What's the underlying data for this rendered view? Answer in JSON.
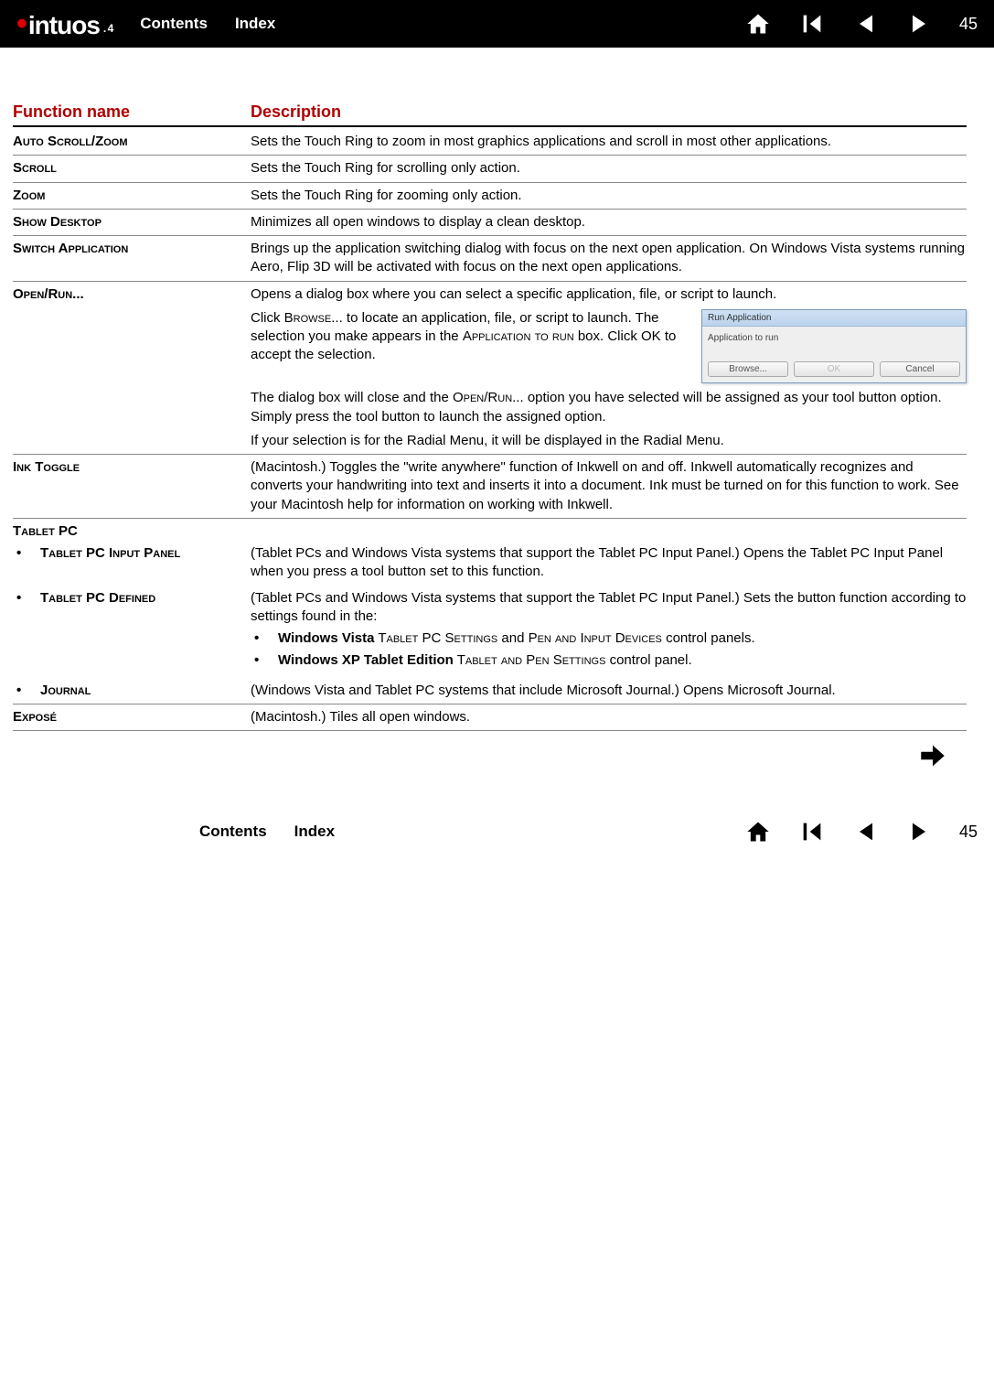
{
  "nav": {
    "contents": "Contents",
    "index": "Index",
    "page": "45",
    "logo_brand": "intuos",
    "logo_sub": "4"
  },
  "headers": {
    "func": "Function name",
    "desc": "Description"
  },
  "rows": {
    "auto_scroll_zoom": {
      "name": "Auto Scroll/Zoom",
      "desc": "Sets the Touch Ring to zoom in most graphics applications and scroll in most other applications."
    },
    "scroll": {
      "name": "Scroll",
      "desc": "Sets the Touch Ring for scrolling only action."
    },
    "zoom": {
      "name": "Zoom",
      "desc": "Sets the Touch Ring for zooming only action."
    },
    "show_desktop": {
      "name": "Show Desktop",
      "desc": "Minimizes all open windows to display a clean desktop."
    },
    "switch_app": {
      "name": "Switch Application",
      "desc": "Brings up the application switching dialog with focus on the next open application. On Windows Vista systems running Aero, Flip 3D will be activated with focus on the next open applications."
    },
    "open_run": {
      "name": "Open/Run...",
      "desc_intro": "Opens a dialog box where you can select a specific application, file, or script to launch.",
      "desc_browse_pre": "Click ",
      "desc_browse_sc": "Browse...",
      "desc_browse_mid": " to locate an application, file, or script  to launch.  The selection you make appears in the ",
      "desc_browse_sc2": "Application to run",
      "desc_browse_post": " box.  Click OK to accept the selection.",
      "desc_close_pre": "The dialog box will close and the ",
      "desc_close_sc": "Open/Run...",
      "desc_close_post": " option you have selected will be assigned as your tool button option.  Simply press the tool button to launch the assigned option.",
      "desc_radial": "If your selection is for the Radial Menu, it will be displayed in the Radial Menu."
    },
    "ink_toggle": {
      "name": "Ink Toggle",
      "desc": "(Macintosh.)  Toggles the \"write anywhere\" function of Inkwell on and off.  Inkwell automatically recognizes and converts your handwriting into text and inserts it into a document.  Ink must be turned on for this function to work.  See your Macintosh help for information on working with Inkwell."
    },
    "tablet_pc": {
      "name": "Tablet PC",
      "input_panel": {
        "name": "Tablet PC Input Panel",
        "desc": "(Tablet PCs and Windows Vista systems that support the Tablet PC Input Panel.) Opens the Tablet PC Input Panel when you press a tool button set to this function."
      },
      "defined": {
        "name": "Tablet PC Defined",
        "desc_intro": "(Tablet PCs and Windows Vista systems that support the Tablet PC Input Panel.) Sets the button function according to settings found in the:",
        "vista_bold": "Windows Vista",
        "vista_sc1": " Tablet PC Settings",
        "vista_mid": " and ",
        "vista_sc2": "Pen and Input Devices",
        "vista_post": " control panels.",
        "xp_bold": "Windows XP Tablet Edition",
        "xp_sc": " Tablet and Pen Settings",
        "xp_post": " control panel."
      },
      "journal": {
        "name": "Journal",
        "desc": "(Windows Vista and Tablet PC systems that include Microsoft Journal.) Opens Microsoft Journal."
      }
    },
    "expose": {
      "name": "Exposé",
      "desc": "(Macintosh.)  Tiles all open windows."
    }
  },
  "dialog": {
    "title": "Run Application",
    "label": "Application to run",
    "browse": "Browse...",
    "ok": "OK",
    "cancel": "Cancel"
  }
}
